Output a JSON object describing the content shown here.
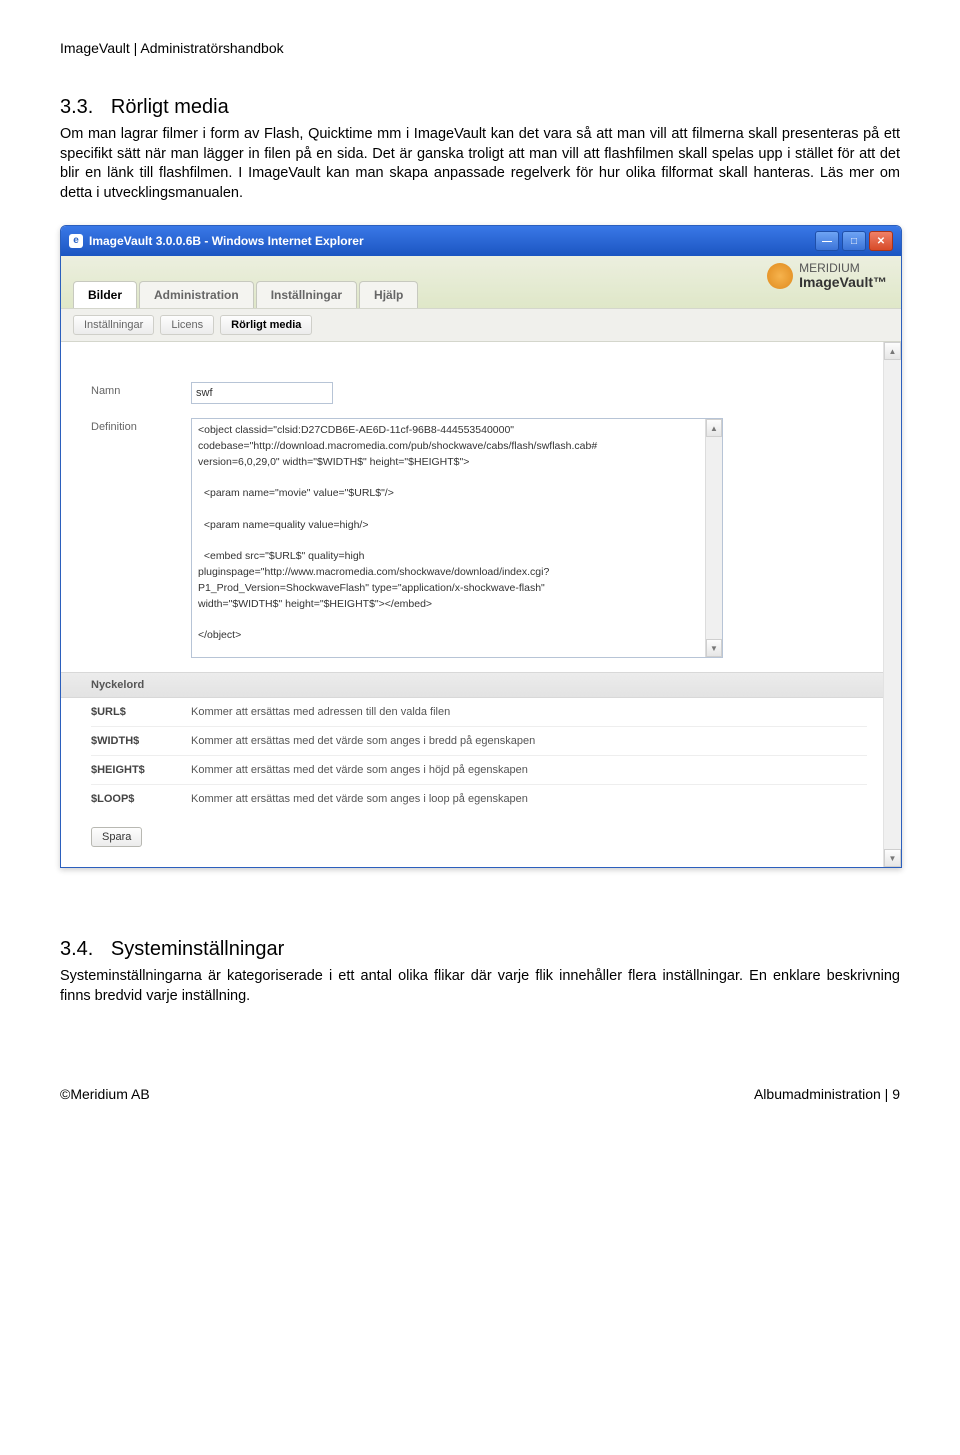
{
  "doc": {
    "header": "ImageVault | Administratörshandbok",
    "section1_num": "3.3.",
    "section1_title": "Rörligt media",
    "section1_body": "Om man lagrar filmer i form av Flash, Quicktime mm i ImageVault kan det vara så att man vill att filmerna skall presenteras på ett specifikt sätt när man lägger in filen på en sida. Det är ganska troligt att man vill att flashfilmen skall spelas upp i stället för att det blir en länk till flashfilmen. I ImageVault kan man skapa anpassade regelverk för hur olika filformat skall hanteras. Läs mer om detta i utvecklingsmanualen.",
    "section2_num": "3.4.",
    "section2_title": "Systeminställningar",
    "section2_body": "Systeminställningarna är kategoriserade i ett antal olika flikar där varje flik innehåller flera inställningar. En enklare beskrivning finns bredvid varje inställning.",
    "footer_left": "©Meridium AB",
    "footer_right": "Albumadministration | 9"
  },
  "window": {
    "title": "ImageVault 3.0.0.6B - Windows Internet Explorer",
    "logo_top": "MERIDIUM",
    "logo_bottom": "ImageVault™",
    "tabs": [
      "Bilder",
      "Administration",
      "Inställningar",
      "Hjälp"
    ],
    "subtabs": [
      "Inställningar",
      "Licens",
      "Rörligt media"
    ],
    "labels": {
      "name": "Namn",
      "definition": "Definition",
      "keyword_header": "Nyckelord",
      "save": "Spara"
    },
    "form": {
      "name_value": "swf",
      "definition_value": "<object classid=\"clsid:D27CDB6E-AE6D-11cf-96B8-444553540000\"\ncodebase=\"http://download.macromedia.com/pub/shockwave/cabs/flash/swflash.cab#\nversion=6,0,29,0\" width=\"$WIDTH$\" height=\"$HEIGHT$\">\n\n  <param name=\"movie\" value=\"$URL$\"/>\n\n  <param name=quality value=high/>\n\n  <embed src=\"$URL$\" quality=high\npluginspage=\"http://www.macromedia.com/shockwave/download/index.cgi?\nP1_Prod_Version=ShockwaveFlash\" type=\"application/x-shockwave-flash\"\nwidth=\"$WIDTH$\" height=\"$HEIGHT$\"></embed>\n\n</object>"
    },
    "keywords": [
      {
        "k": "$URL$",
        "d": "Kommer att ersättas med adressen till den valda filen"
      },
      {
        "k": "$WIDTH$",
        "d": "Kommer att ersättas med det värde som anges i bredd på egenskapen"
      },
      {
        "k": "$HEIGHT$",
        "d": "Kommer att ersättas med det värde som anges i höjd på egenskapen"
      },
      {
        "k": "$LOOP$",
        "d": "Kommer att ersättas med det värde som anges i loop på egenskapen"
      }
    ]
  }
}
